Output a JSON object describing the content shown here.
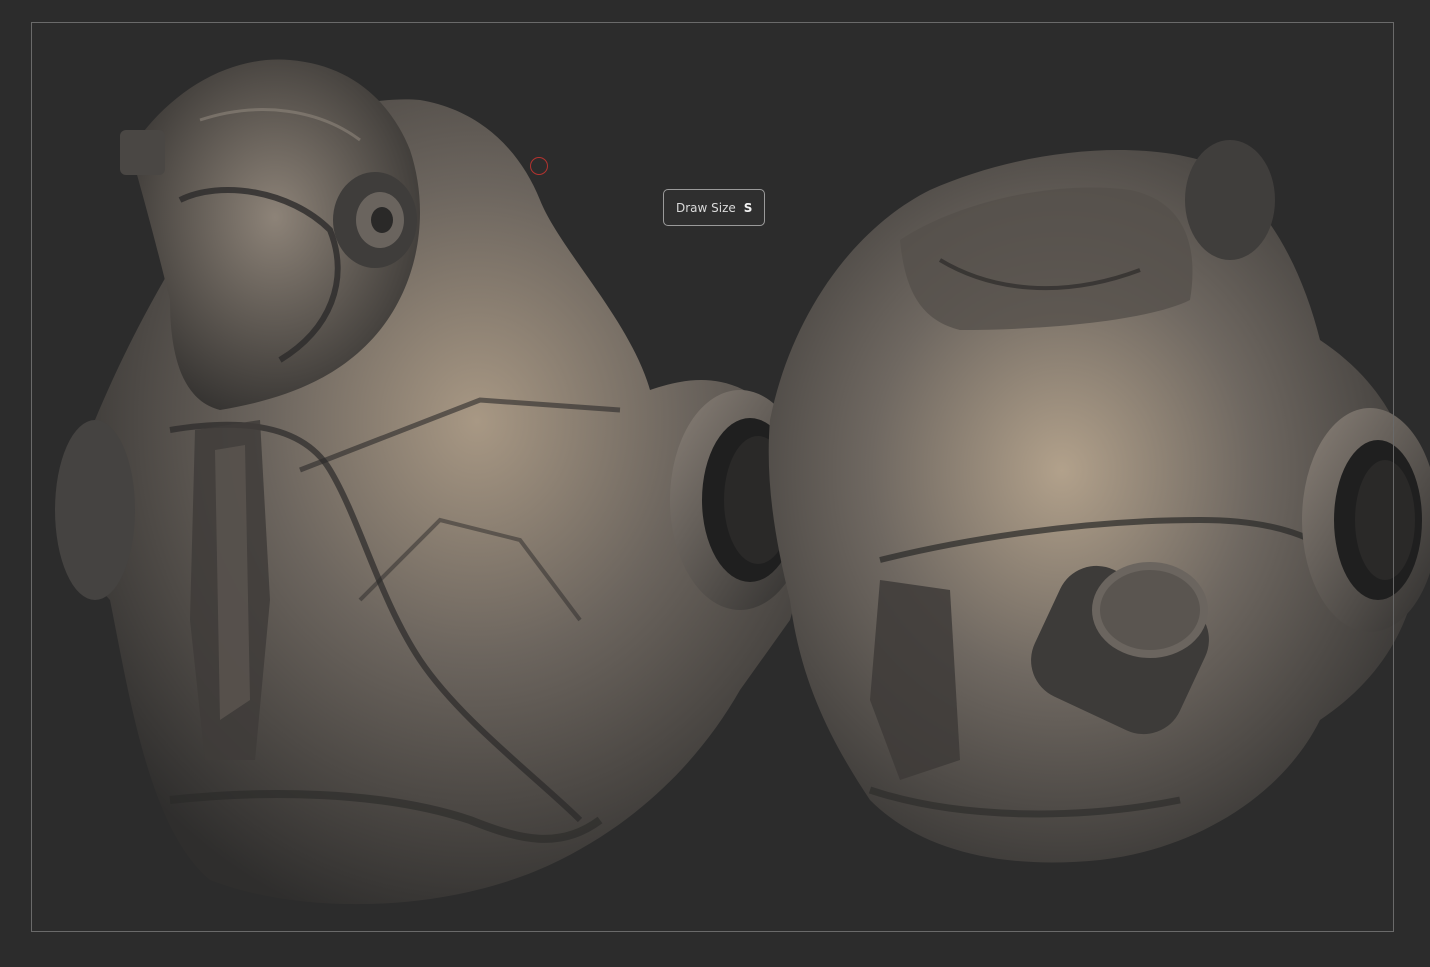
{
  "tooltip": {
    "label": "Draw Size",
    "hotkey": "S"
  },
  "colors": {
    "background": "#2c2c2c",
    "frame": "#6a6a6a",
    "brush_cursor": "#b3332f",
    "clay_light": "#b8a894",
    "clay_dark": "#3a3837"
  },
  "icons": {
    "brush_cursor": "circle-outline"
  }
}
